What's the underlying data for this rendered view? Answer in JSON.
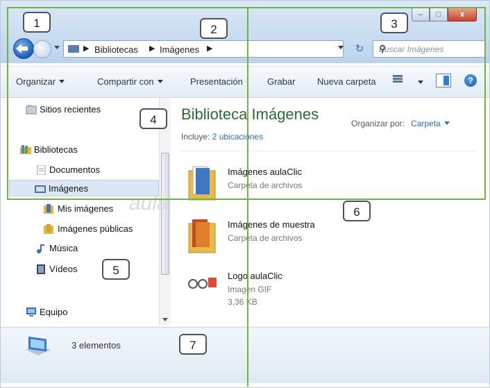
{
  "breadcrumb": [
    "Bibliotecas",
    "Imágenes"
  ],
  "search": {
    "placeholder": "Buscar Imágenes"
  },
  "window_buttons": {
    "min": "–",
    "max": "□",
    "close": "x"
  },
  "toolbar": {
    "organize": "Organizar",
    "share": "Compartir con",
    "slideshow": "Presentación",
    "burn": "Grabar",
    "new_folder": "Nueva carpeta",
    "help": "?"
  },
  "nav": {
    "recent": "Sitios recientes",
    "libraries": "Bibliotecas",
    "documents": "Documentos",
    "images": "Imágenes",
    "my_images": "Mis imágenes",
    "public_images": "Imágenes públicas",
    "music": "Música",
    "videos": "Vídeos",
    "computer": "Equipo"
  },
  "library": {
    "title": "Biblioteca Imágenes",
    "includes_label": "Incluye:",
    "includes_link": "2 ubicaciones",
    "arrange_label": "Organizar por:",
    "arrange_value": "Carpeta"
  },
  "files": [
    {
      "name": "Imágenes aulaClic",
      "type": "Carpeta de archivos",
      "size": ""
    },
    {
      "name": "Imágenes de muestra",
      "type": "Carpeta de archivos",
      "size": ""
    },
    {
      "name": "Logo aulaClic",
      "type": "Imagen GIF",
      "size": "3,36 KB"
    }
  ],
  "status": {
    "count": "3 elementos"
  },
  "callouts": [
    "1",
    "2",
    "3",
    "4",
    "5",
    "6",
    "7"
  ],
  "watermark": "aula",
  "colors": {
    "guide_lines": "#6db53e",
    "library_title": "#2d6b2f",
    "link": "#2a6db5"
  }
}
